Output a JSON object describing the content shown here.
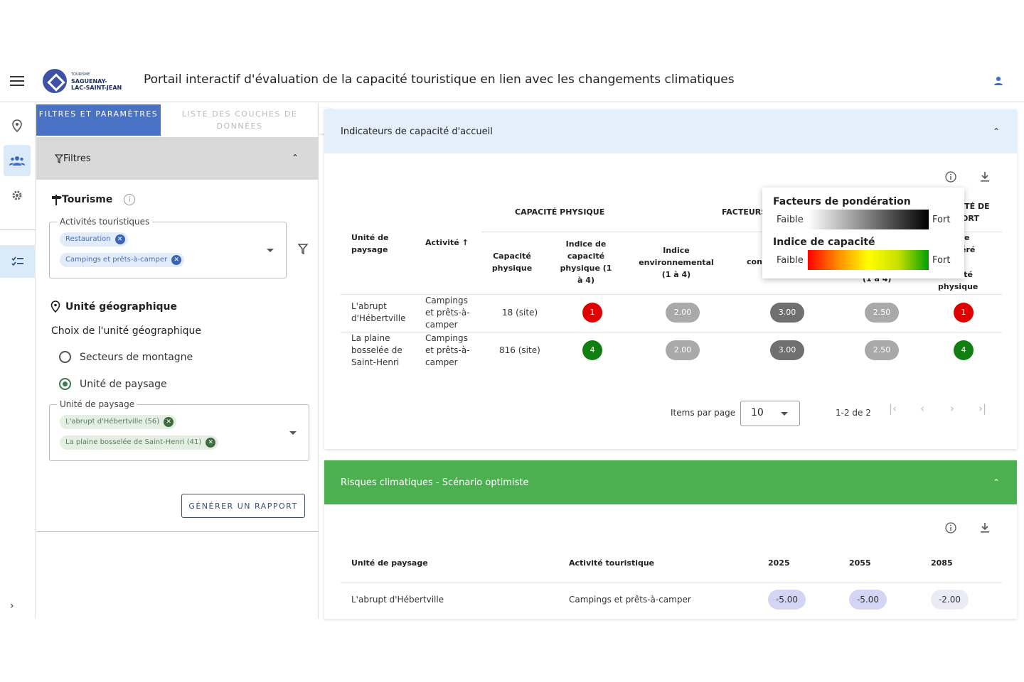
{
  "header": {
    "title": "Portail interactif d'évaluation de la capacité touristique en lien avec les changements climatiques",
    "logo": {
      "small": "TOURISME",
      "line1": "SAGUENAY-",
      "line2": "LAC-SAINT-JEAN"
    }
  },
  "tabs": {
    "filters": "FILTRES ET PARAMÈTRES",
    "layers": "LISTE DES COUCHES DE DONNÉES"
  },
  "filters": {
    "bar_label": "Filtres",
    "tourism_title": "Tourisme",
    "activities_legend": "Activités touristiques",
    "activities": [
      "Restauration",
      "Campings et prêts-à-camper"
    ],
    "geo_title": "Unité géographique",
    "geo_choice_label": "Choix de l'unité géographique",
    "radio_mountain": "Secteurs de montagne",
    "radio_landscape": "Unité de paysage",
    "unit_legend": "Unité de paysage",
    "units": [
      "L'abrupt d'Hébertville (56)",
      "La plaine bosselée de Saint-Henri (41)"
    ],
    "generate_button": "GÉNÉRER UN RAPPORT"
  },
  "capacity": {
    "title": "Indicateurs de capacité d'accueil",
    "group_physique": "CAPACITÉ PHYSIQUE",
    "group_facteurs": "FACTEURS",
    "group_cut": "CITÉ DE PORT",
    "col_unite": "Unité de paysage",
    "col_activite": "Activité",
    "col_capacite": "Capacité physique",
    "col_indice": "Indice de capacité physique (1 à 4)",
    "col_env": "Indice environnemental (1 à 4)",
    "col_con": "con",
    "col_cut_a": "(1 à 4)",
    "col_cut_b1": "e",
    "col_cut_b2": "éré",
    "col_cut_b3": "cité",
    "col_cut_b4": "physique",
    "rows": [
      {
        "unite": "L'abrupt d'Hébertville",
        "activite": "Campings et prêts-à-camper",
        "capacite": "18 (site)",
        "indice": "1",
        "env": "2.00",
        "f2": "3.00",
        "f3": "2.50",
        "final": "1"
      },
      {
        "unite": "La plaine bosselée de Saint-Henri",
        "activite": "Campings et prêts-à-camper",
        "capacite": "816 (site)",
        "indice": "4",
        "env": "2.00",
        "f2": "3.00",
        "f3": "2.50",
        "final": "4"
      }
    ],
    "items_per_page_label": "Items par page",
    "items_per_page": "10",
    "range": "1-2 de 2"
  },
  "legend_popup": {
    "weighting_title": "Facteurs de pondération",
    "capacity_title": "Indice de capacité",
    "low": "Faible",
    "high": "Fort"
  },
  "risks": {
    "title": "Risques climatiques - Scénario optimiste",
    "col_unite": "Unité de paysage",
    "col_activite": "Activité touristique",
    "years": [
      "2025",
      "2055",
      "2085"
    ],
    "row": {
      "unite": "L'abrupt d'Hébertville",
      "activite": "Campings et prêts-à-camper",
      "values": [
        "-5.00",
        "-5.00",
        "-2.00"
      ]
    }
  },
  "colors": {
    "primary": "#4a72c4",
    "green_header": "#4caf50",
    "blue_header": "#e3f0fb",
    "red": "#e00000",
    "green": "#0f7f10",
    "grey_light": "#a9a9a9",
    "grey_dark": "#707070"
  }
}
